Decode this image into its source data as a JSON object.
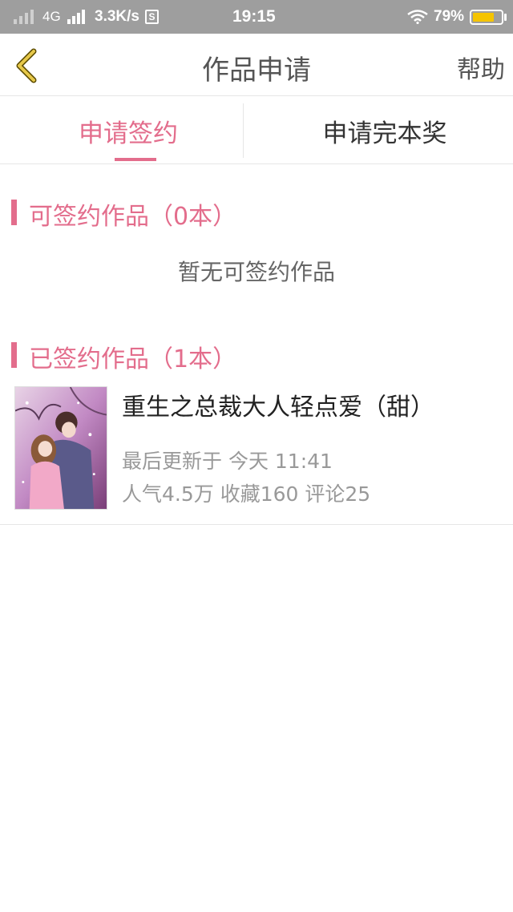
{
  "status_bar": {
    "network": "4G",
    "speed": "3.3K/s",
    "s_badge": "S",
    "time": "19:15",
    "battery_percent": "79%",
    "battery_level": 0.79,
    "icons": [
      "signal-icon",
      "signal-icon",
      "wifi-icon",
      "battery-icon"
    ]
  },
  "header": {
    "back_icon": "chevron-left-icon",
    "title": "作品申请",
    "help_label": "帮助",
    "accent_color": "#e6c84a"
  },
  "tabs": [
    {
      "label": "申请签约",
      "active": true
    },
    {
      "label": "申请完本奖",
      "active": false
    }
  ],
  "sections": {
    "available": {
      "title": "可签约作品（0本）",
      "empty_text": "暂无可签约作品"
    },
    "signed": {
      "title": "已签约作品（1本）",
      "items": [
        {
          "title": "重生之总裁大人轻点爱（甜）",
          "updated": "最后更新于 今天 11:41",
          "stats": "人气4.5万 收藏160 评论25"
        }
      ]
    }
  },
  "colors": {
    "accent": "#e36d8c",
    "status_bar_bg": "#9e9e9e",
    "battery_fill": "#f5c400"
  }
}
